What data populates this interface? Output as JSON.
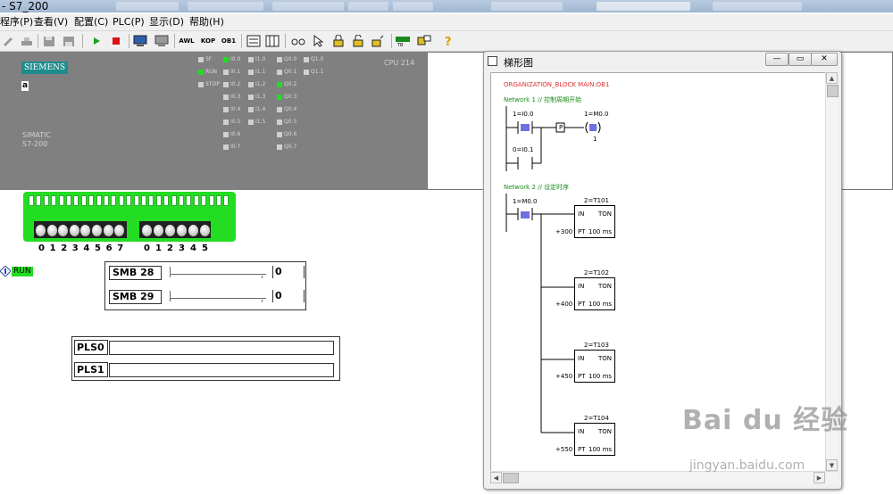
{
  "window": {
    "title": "- S7_200"
  },
  "menu": {
    "items": [
      "程序(P)",
      "查看(V)",
      "配置(C)",
      "PLC(P)",
      "显示(D)",
      "帮助(H)"
    ]
  },
  "toolbar": {
    "awl": "AWL",
    "kop": "KOP",
    "ob1": "OB1",
    "tb_label": "TB"
  },
  "plc": {
    "brand": "SIEMENS",
    "mode_char": "a",
    "model_line1": "SIMATIC",
    "model_line2": "S7-200",
    "cpu": "CPU 214",
    "status_leds": [
      {
        "label": "SF",
        "on": false
      },
      {
        "label": "RUN",
        "on": true
      },
      {
        "label": "STOP",
        "on": false
      }
    ],
    "inputs_col1": [
      {
        "label": "I0.0",
        "on": true
      },
      {
        "label": "I0.1",
        "on": false
      },
      {
        "label": "I0.2",
        "on": false
      },
      {
        "label": "I0.3",
        "on": false
      },
      {
        "label": "I0.4",
        "on": false
      },
      {
        "label": "I0.5",
        "on": false
      },
      {
        "label": "I0.6",
        "on": false
      },
      {
        "label": "I0.7",
        "on": false
      }
    ],
    "inputs_col2": [
      {
        "label": "I1.0",
        "on": false
      },
      {
        "label": "I1.1",
        "on": false
      },
      {
        "label": "I1.2",
        "on": false
      },
      {
        "label": "I1.3",
        "on": false
      },
      {
        "label": "I1.4",
        "on": false
      },
      {
        "label": "I1.5",
        "on": false
      }
    ],
    "outputs_col1": [
      {
        "label": "Q0.0",
        "on": false
      },
      {
        "label": "Q0.1",
        "on": false
      },
      {
        "label": "Q0.2",
        "on": true
      },
      {
        "label": "Q0.3",
        "on": true
      },
      {
        "label": "Q0.4",
        "on": false
      },
      {
        "label": "Q0.5",
        "on": false
      },
      {
        "label": "Q0.6",
        "on": false
      },
      {
        "label": "Q0.7",
        "on": false
      }
    ],
    "outputs_col2": [
      {
        "label": "Q1.0",
        "on": false
      },
      {
        "label": "Q1.1",
        "on": false
      }
    ]
  },
  "switches": {
    "group1": [
      "0",
      "1",
      "2",
      "3",
      "4",
      "5",
      "6",
      "7"
    ],
    "group2": [
      "0",
      "1",
      "2",
      "3",
      "4",
      "5"
    ]
  },
  "run_label": "RUN",
  "smb": [
    {
      "label": "SMB 28",
      "value": "0",
      "level": 0
    },
    {
      "label": "SMB 29",
      "value": "0",
      "level": 0
    }
  ],
  "pls": [
    {
      "label": "PLS0",
      "value": ""
    },
    {
      "label": "PLS1",
      "value": ""
    }
  ],
  "ladder": {
    "title": "梯形图",
    "org_block": "ORGANIZATION_BLOCK MAIN:OB1",
    "network1": {
      "header": "Network 1 // 控制周期开始",
      "contact1": "1=I0.0",
      "contact2": "0=I0.1",
      "coil_addr": "1=M0.0",
      "p_label": "P",
      "coil_type": "S",
      "coil_count": "1"
    },
    "network2": {
      "header": "Network 2 // 设定时序",
      "contact": "1=M0.0",
      "timers": [
        {
          "name": "2=T101",
          "in": "IN",
          "type": "TON",
          "pt": "PT",
          "base": "100 ms",
          "preset": "+300"
        },
        {
          "name": "2=T102",
          "in": "IN",
          "type": "TON",
          "pt": "PT",
          "base": "100 ms",
          "preset": "+400"
        },
        {
          "name": "2=T103",
          "in": "IN",
          "type": "TON",
          "pt": "PT",
          "base": "100 ms",
          "preset": "+450"
        },
        {
          "name": "2=T104",
          "in": "IN",
          "type": "TON",
          "pt": "PT",
          "base": "100 ms",
          "preset": "+550"
        }
      ]
    }
  },
  "watermark": {
    "brand": "Bai du 经验",
    "url": "jingyan.baidu.com"
  },
  "colors": {
    "led_on": "#22dd22",
    "plc_body": "#808080",
    "brand_bg": "#1e8c8c",
    "org_text": "#e03030",
    "network_text": "#1a8a1a"
  }
}
